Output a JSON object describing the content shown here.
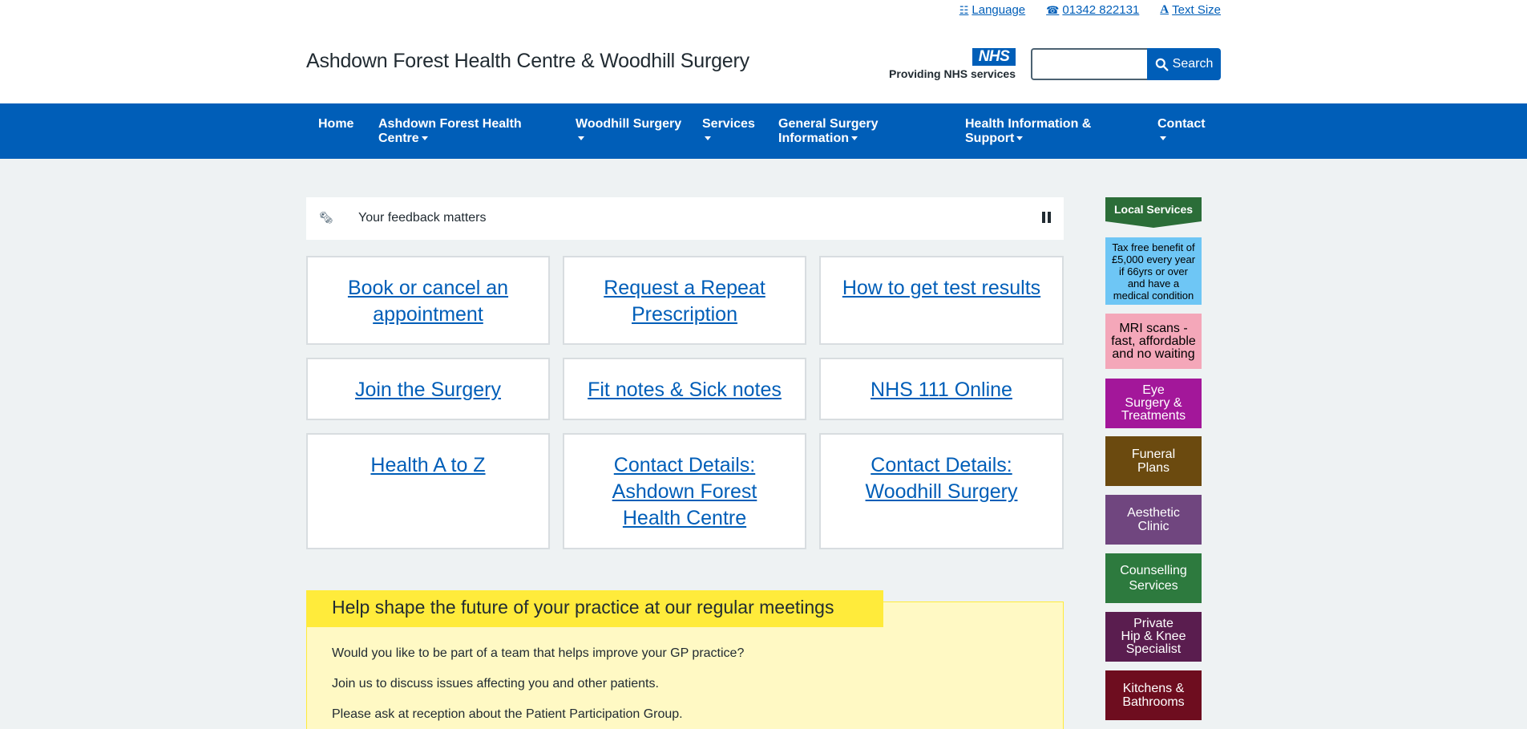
{
  "utility": {
    "language": "Language",
    "phone": "01342 822131",
    "text_size": "Text Size"
  },
  "site_title": "Ashdown Forest Health Centre & Woodhill Surgery",
  "nhs": {
    "logo": "NHS",
    "tagline": "Providing NHS services"
  },
  "search": {
    "value": "",
    "button_label": "Search"
  },
  "nav": [
    {
      "line1": "Home",
      "line2": ""
    },
    {
      "line1": "Ashdown Forest Health",
      "line2": "Centre"
    },
    {
      "line1": "Woodhill Surgery",
      "line2": ""
    },
    {
      "line1": "Services",
      "line2": ""
    },
    {
      "line1": "General Surgery",
      "line2": "Information"
    },
    {
      "line1": "Health Information &",
      "line2": "Support"
    },
    {
      "line1": "Contact",
      "line2": ""
    }
  ],
  "feedback": {
    "text": "Your feedback matters"
  },
  "tiles": [
    "Book or cancel an appointment",
    "Request a Repeat Prescription",
    "How to get test results",
    "Join the Surgery",
    "Fit notes & Sick notes",
    "NHS 111 Online",
    "Health A to Z",
    "Contact Details: Ashdown Forest Health Centre",
    "Contact Details: Woodhill Surgery"
  ],
  "panel": {
    "heading": "Help shape the future of your practice at our regular meetings",
    "paragraphs": [
      "Would you like to be part of a team that helps improve your GP practice?",
      "Join us to discuss issues affecting you and other patients.",
      "Please ask at reception about the Patient Participation Group."
    ]
  },
  "side": {
    "heading": "Local Services",
    "ads": [
      {
        "line1": "Tax free benefit of",
        "line2": "£5,000 every year",
        "line3": "if 66yrs or over",
        "line4": "and have a",
        "line5": "medical condition",
        "bg": "#6ec6f5",
        "fg": "#000000"
      },
      {
        "line1": "MRI scans -",
        "line2": "fast, affordable",
        "line3": "and no waiting",
        "bg": "#f4a7b9",
        "fg": "#000000"
      },
      {
        "line1": "Eye",
        "line2": "Surgery &",
        "line3": "Treatments",
        "bg": "#a3179a",
        "fg": "#ffffff"
      },
      {
        "line1": "Funeral",
        "line2": "Plans",
        "bg": "#6b4a0f",
        "fg": "#ffffff"
      },
      {
        "line1": "Aesthetic",
        "line2": "Clinic",
        "bg": "#70467f",
        "fg": "#ffffff"
      },
      {
        "line1": "Counselling",
        "line2": "Services",
        "bg": "#2d7a3e",
        "fg": "#ffffff"
      },
      {
        "line1": "Private",
        "line2": "Hip & Knee",
        "line3": "Specialist",
        "bg": "#5a1d4f",
        "fg": "#ffffff"
      },
      {
        "line1": "Kitchens &",
        "line2": "Bathrooms",
        "bg": "#6e0d1f",
        "fg": "#ffffff"
      }
    ]
  },
  "colors": {
    "nhs_blue": "#005eb8",
    "page_bg": "#eef2f3",
    "panel_yellow": "#fff9c4",
    "panel_head_yellow": "#ffeb3b"
  }
}
